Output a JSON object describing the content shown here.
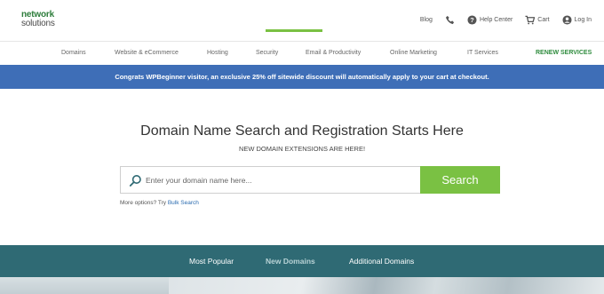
{
  "logo": {
    "line1": "network",
    "line2": "solutions"
  },
  "utility": {
    "blog": "Blog",
    "help": "Help Center",
    "cart": "Cart",
    "login": "Log In"
  },
  "nav": {
    "items": [
      "Domains",
      "Website & eCommerce",
      "Hosting",
      "Security",
      "Email & Productivity",
      "Online Marketing",
      "IT Services"
    ],
    "renew": "RENEW SERVICES"
  },
  "promo": "Congrats WPBeginner visitor, an exclusive 25% off sitewide discount will automatically apply to your cart at checkout.",
  "hero": {
    "title": "Domain Name Search and Registration Starts Here",
    "subtitle": "NEW DOMAIN EXTENSIONS ARE HERE!",
    "search_placeholder": "Enter your domain name here...",
    "search_button": "Search",
    "more_prefix": "More options? Try ",
    "more_link": "Bulk Search"
  },
  "tabs": {
    "items": [
      "Most Popular",
      "New Domains",
      "Additional Domains"
    ],
    "active": "New Domains"
  },
  "colors": {
    "brand_green": "#2e7d3c",
    "promo_blue": "#3e6eb7",
    "search_green": "#7ac143",
    "tabs_teal": "#2f6a74"
  }
}
